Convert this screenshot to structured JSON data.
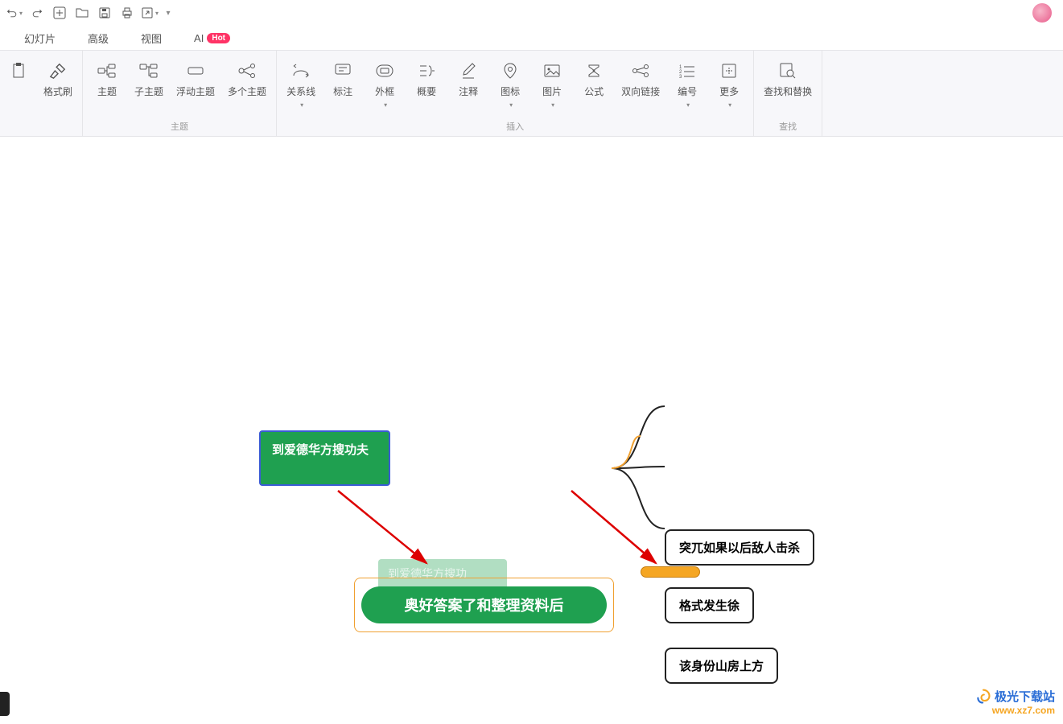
{
  "qat": {
    "undo": "撤销",
    "redo": "重做",
    "new": "新建",
    "open": "打开",
    "save": "保存",
    "print": "打印",
    "share": "分享"
  },
  "menubar": {
    "slide": "幻灯片",
    "advanced": "高级",
    "view": "视图",
    "ai": "AI",
    "hot": "Hot"
  },
  "ribbon": {
    "format_painter": "格式刷",
    "topic": "主题",
    "subtopic": "子主题",
    "floating": "浮动主题",
    "multiple": "多个主题",
    "group_topic": "主题",
    "relation": "关系线",
    "callout": "标注",
    "boundary": "外框",
    "summary": "概要",
    "note": "注释",
    "icon": "图标",
    "image": "图片",
    "formula": "公式",
    "hyperlink": "双向链接",
    "numbering": "编号",
    "more": "更多",
    "group_insert": "插入",
    "find_replace": "查找和替换",
    "group_find": "查找"
  },
  "mindmap": {
    "floating_node": "到爱德华方搜功夫",
    "ghost_node": "到爱德华方搜功",
    "central": "奥好答案了和整理资料后",
    "child1": "突兀如果以后敌人击杀",
    "child2": "格式发生徐",
    "child3": "该身份山房上方"
  },
  "watermark": {
    "line1": "极光下载站",
    "line2": "www.xz7.com"
  }
}
